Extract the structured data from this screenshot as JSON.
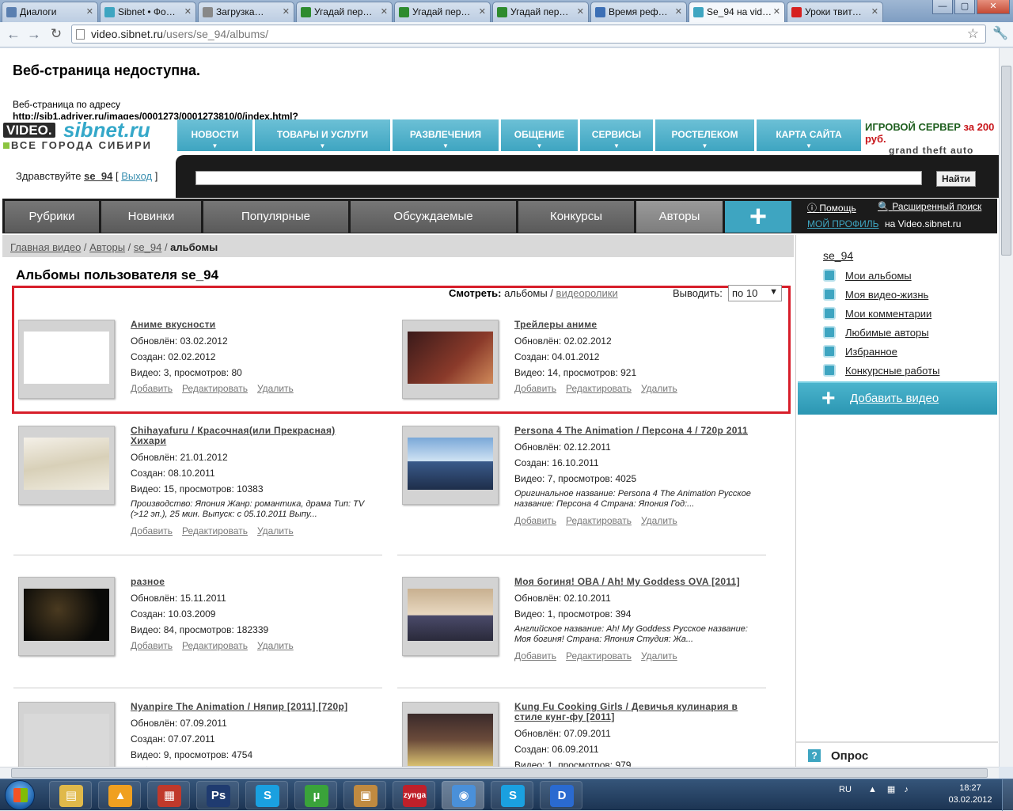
{
  "browser": {
    "tabs": [
      {
        "label": "Диалоги",
        "color": "#5a7fb0"
      },
      {
        "label": "Sibnet • Фо…",
        "color": "#3ea5c1"
      },
      {
        "label": "Загрузка…",
        "color": "#888888"
      },
      {
        "label": "Угадай пер…",
        "color": "#2e8b2e"
      },
      {
        "label": "Угадай пер…",
        "color": "#2e8b2e"
      },
      {
        "label": "Угадай пер…",
        "color": "#2e8b2e"
      },
      {
        "label": "Время реф…",
        "color": "#3c6fb5"
      },
      {
        "label": "Se_94 на vid…",
        "color": "#3ea5c1"
      },
      {
        "label": "Уроки твит…",
        "color": "#d62020"
      }
    ],
    "url_host": "video.sibnet.ru",
    "url_path": "/users/se_94/albums/"
  },
  "error": {
    "title": "Веб-страница недоступна.",
    "text": "Веб-страница по адресу",
    "url": "http://sib1.adriver.ru/images/0001273/0001273810/0/index.html?"
  },
  "logo": {
    "video": "VIDEO.",
    "sibnet": "sibnet.ru",
    "sub": "ВСЕ ГОРОДА СИБИРИ"
  },
  "topnav": [
    {
      "label": "НОВОСТИ",
      "w": 95
    },
    {
      "label": "ТОВАРЫ И УСЛУГИ",
      "w": 171
    },
    {
      "label": "РАЗВЛЕЧЕНИЯ",
      "w": 134
    },
    {
      "label": "ОБЩЕНИЕ",
      "w": 97
    },
    {
      "label": "СЕРВИСЫ",
      "w": 92
    },
    {
      "label": "РОСТЕЛЕКОМ",
      "w": 125
    },
    {
      "label": "КАРТА САЙТА",
      "w": 132
    }
  ],
  "banner": {
    "line1": "ИГРОВОЙ СЕРВЕР",
    "line1_accent": "за 200 руб.",
    "line2": "grand theft auto"
  },
  "greeting": {
    "text": "Здравствуйте",
    "user": "se_94",
    "logout": "Выход",
    "open": "[",
    "close": "]"
  },
  "search": {
    "button": "Найти",
    "value": ""
  },
  "mainnav": {
    "items": [
      "Рубрики",
      "Новинки",
      "Популярные",
      "Обсуждаемые",
      "Конкурсы",
      "Авторы"
    ],
    "plus": "+"
  },
  "rightbox": {
    "help": "Помощь",
    "advanced": "Расширенный поиск",
    "profile": "МОЙ ПРОФИЛЬ",
    "on": "на Video.sibnet.ru"
  },
  "breadcrumb": {
    "items": [
      "Главная видео",
      "Авторы",
      "se_94"
    ],
    "current": "альбомы",
    "sep": " / "
  },
  "sidebar": {
    "user": "se_94",
    "links": [
      "Мои альбомы",
      "Моя видео-жизнь",
      "Мои комментарии",
      "Любимые авторы",
      "Избранное",
      "Конкурсные работы"
    ],
    "add_video": "Добавить видео",
    "poll": "Опрос"
  },
  "page_title": "Альбомы пользователя se_94",
  "view": {
    "label": "Смотреть:",
    "current": "альбомы",
    "sep": " / ",
    "other": "видеоролики"
  },
  "perpage": {
    "label": "Выводить:",
    "value": "по 10"
  },
  "labels": {
    "updated": "Обновлён: ",
    "created": "Создан: ",
    "add": "Добавить",
    "edit": "Редактировать",
    "delete": "Удалить"
  },
  "albums": [
    {
      "title": "Аниме вкусности",
      "updated": "03.02.2012",
      "created": "02.02.2012",
      "stats": "Видео: 3, просмотров: 80",
      "desc": ""
    },
    {
      "title": "Трейлеры аниме",
      "updated": "02.02.2012",
      "created": "04.01.2012",
      "stats": "Видео: 14, просмотров: 921",
      "desc": ""
    },
    {
      "title": "Chihayafuru / Красочная(или Прекрасная) Хихари",
      "updated": "21.01.2012",
      "created": "08.10.2011",
      "stats": "Видео: 15, просмотров: 10383",
      "desc": "Производство: Япония Жанр: романтика, драма Тип: TV (>12 эп.), 25 мин. Выпуск: с 05.10.2011 Выпу..."
    },
    {
      "title": "Persona 4 The Animation / Персона 4 / 720p 2011",
      "updated": "02.12.2011",
      "created": "16.10.2011",
      "stats": "Видео: 7, просмотров: 4025",
      "desc": "Оригинальное название: Persona 4 The Animation Русское название: Персона 4 Страна: Япония Год:..."
    },
    {
      "title": "разное",
      "updated": "15.11.2011",
      "created": "10.03.2009",
      "stats": "Видео: 84, просмотров: 182339",
      "desc": ""
    },
    {
      "title": "Моя богиня! OBA / Ah! My Goddess OVA [2011]",
      "updated": "02.10.2011",
      "created": "",
      "stats": "Видео: 1, просмотров: 394",
      "desc": "Английское название: Ah! My Goddess Русское название: Моя богиня! Страна: Япония Студия: Жа..."
    },
    {
      "title": "Nyanpire The Animation / Няпир [2011] [720p]",
      "updated": "07.09.2011",
      "created": "07.07.2011",
      "stats": "Видео: 9, просмотров: 4754",
      "desc": ""
    },
    {
      "title": "Kung Fu Cooking Girls / Девичья кулинария в стиле кунг-фу [2011]",
      "updated": "07.09.2011",
      "created": "06.09.2011",
      "stats": "Видео: 1, просмотров: 979",
      "desc": ""
    }
  ],
  "taskbar": {
    "apps": [
      {
        "name": "explorer",
        "glyph": "▤",
        "color": "#e0b94a"
      },
      {
        "name": "aimp",
        "glyph": "▲",
        "color": "#f0a020"
      },
      {
        "name": "media",
        "glyph": "▦",
        "color": "#c0392b"
      },
      {
        "name": "photoshop",
        "glyph": "Ps",
        "color": "#1f3b70"
      },
      {
        "name": "skype",
        "glyph": "S",
        "color": "#1aa0e0"
      },
      {
        "name": "utorrent",
        "glyph": "µ",
        "color": "#3aa33a"
      },
      {
        "name": "package",
        "glyph": "▣",
        "color": "#c08a40"
      },
      {
        "name": "zynga",
        "glyph": "zynga",
        "color": "#c0202a"
      },
      {
        "name": "chrome",
        "glyph": "◉",
        "color": "#4a90d9"
      },
      {
        "name": "skype2",
        "glyph": "S",
        "color": "#1aa0e0"
      },
      {
        "name": "daemon",
        "glyph": "D",
        "color": "#2a6ad0"
      }
    ],
    "lang": "RU",
    "time": "18:27",
    "date": "03.02.2012"
  }
}
